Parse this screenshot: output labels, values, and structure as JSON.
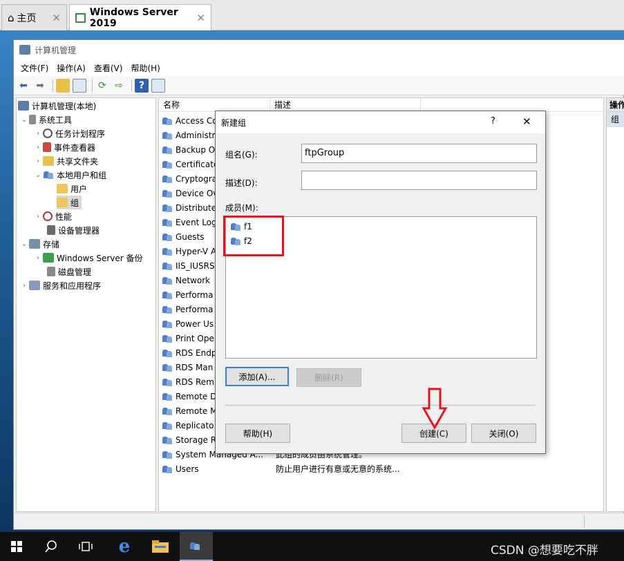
{
  "vm_tabs": [
    {
      "label": "主页",
      "icon": "home-icon"
    },
    {
      "label": "Windows Server 2019",
      "icon": "vm-icon"
    }
  ],
  "window": {
    "title": "计算机管理",
    "menu": [
      "文件(F)",
      "操作(A)",
      "查看(V)",
      "帮助(H)"
    ]
  },
  "tree": [
    {
      "label": "计算机管理(本地)",
      "icon": "computer-management-icon"
    },
    {
      "label": "系统工具",
      "icon": "tools-icon"
    },
    {
      "label": "任务计划程序",
      "icon": "clock-icon"
    },
    {
      "label": "事件查看器",
      "icon": "event-viewer-icon"
    },
    {
      "label": "共享文件夹",
      "icon": "shared-folder-icon"
    },
    {
      "label": "本地用户和组",
      "icon": "users-icon"
    },
    {
      "label": "用户",
      "icon": "folder-icon"
    },
    {
      "label": "组",
      "icon": "folder-icon"
    },
    {
      "label": "性能",
      "icon": "performance-icon"
    },
    {
      "label": "设备管理器",
      "icon": "device-manager-icon"
    },
    {
      "label": "存储",
      "icon": "storage-icon"
    },
    {
      "label": "Windows Server 备份",
      "icon": "backup-icon"
    },
    {
      "label": "磁盘管理",
      "icon": "disk-icon"
    },
    {
      "label": "服务和应用程序",
      "icon": "services-icon"
    }
  ],
  "list": {
    "headers": [
      "名称",
      "描述"
    ],
    "rows": [
      {
        "name": "Access Co",
        "desc": ""
      },
      {
        "name": "Administr",
        "desc": ""
      },
      {
        "name": "Backup O",
        "desc": ""
      },
      {
        "name": "Certificate",
        "desc": ""
      },
      {
        "name": "Cryptogra",
        "desc": ""
      },
      {
        "name": "Device Ov",
        "desc": ""
      },
      {
        "name": "Distribute",
        "desc": ""
      },
      {
        "name": "Event Log",
        "desc": ""
      },
      {
        "name": "Guests",
        "desc": ""
      },
      {
        "name": "Hyper-V A",
        "desc": ""
      },
      {
        "name": "IIS_IUSRS",
        "desc": ""
      },
      {
        "name": "Network",
        "desc": ""
      },
      {
        "name": "Performa",
        "desc": ""
      },
      {
        "name": "Performa",
        "desc": ""
      },
      {
        "name": "Power Us",
        "desc": ""
      },
      {
        "name": "Print Ope",
        "desc": ""
      },
      {
        "name": "RDS Endp",
        "desc": ""
      },
      {
        "name": "RDS Man",
        "desc": ""
      },
      {
        "name": "RDS Rem",
        "desc": ""
      },
      {
        "name": "Remote D",
        "desc": ""
      },
      {
        "name": "Remote M",
        "desc": ""
      },
      {
        "name": "Replicato",
        "desc": ""
      },
      {
        "name": "Storage R",
        "desc": ""
      },
      {
        "name": "System Managed A...",
        "desc": "此组的成员由系统管理。"
      },
      {
        "name": "Users",
        "desc": "防止用户进行有意或无意的系统..."
      }
    ]
  },
  "actions": {
    "header": "操作",
    "item": "组"
  },
  "dialog": {
    "title": "新建组",
    "help_glyph": "?",
    "close_glyph": "✕",
    "group_name_label": "组名(G):",
    "group_name_value": "ftpGroup",
    "desc_label": "描述(D):",
    "desc_value": "",
    "members_label": "成员(M):",
    "members": [
      "f1",
      "f2"
    ],
    "add_button": "添加(A)...",
    "remove_button": "删除(R)",
    "help_button": "帮助(H)",
    "create_button": "创建(C)",
    "close_button": "关闭(O)"
  },
  "annotation_color": "#e8141c",
  "taskbar": {
    "watermark": "CSDN @想要吃不胖"
  }
}
